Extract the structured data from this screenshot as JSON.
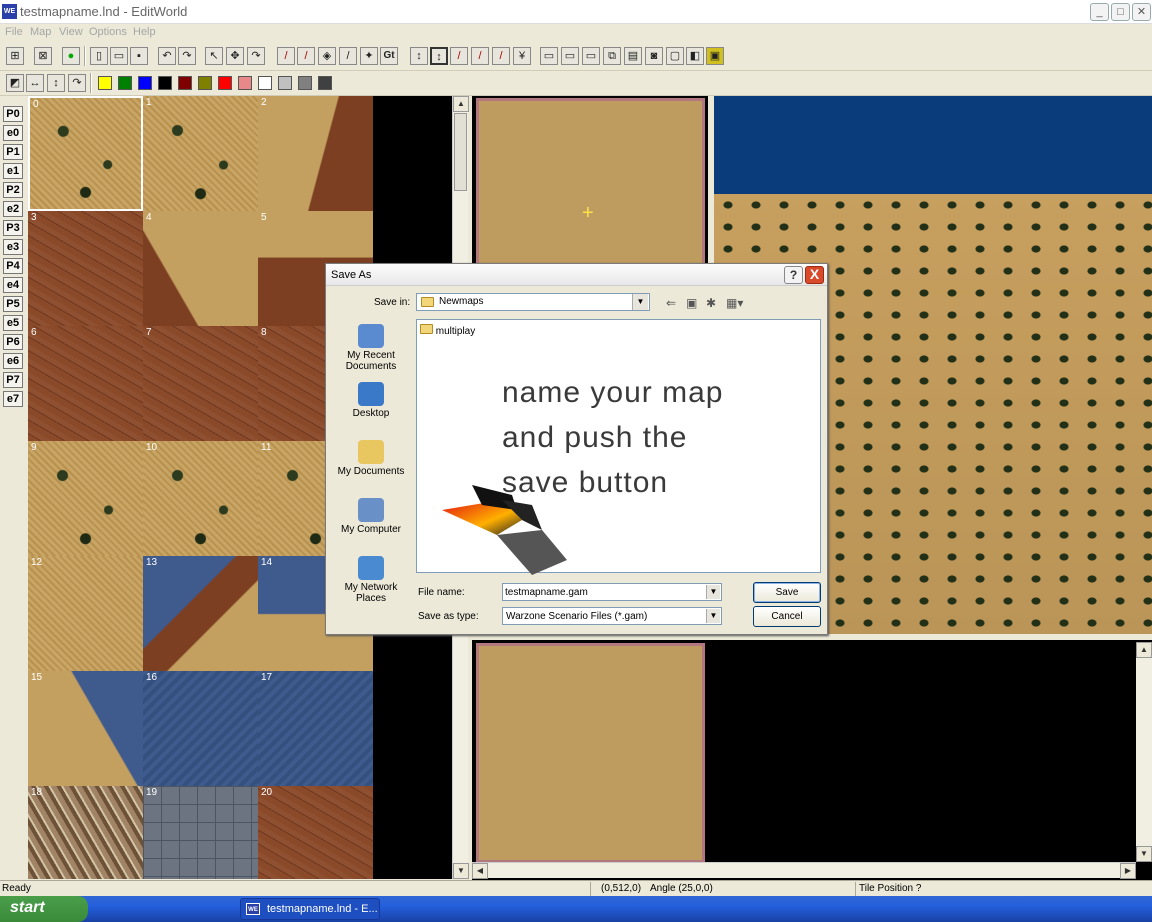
{
  "window": {
    "title": "testmapname.lnd - EditWorld",
    "app_icon": "WE"
  },
  "menu": [
    "File",
    "Map",
    "View",
    "Options",
    "Help"
  ],
  "toolbar1": {
    "gt_label": "Gt",
    "icons": [
      "toggle-icon",
      "target-icon",
      "circle-icon",
      "new-file-icon",
      "open-folder-icon",
      "save-icon",
      "undo-icon",
      "redo-icon",
      "pointer-icon",
      "move-icon",
      "rotate-icon",
      "paint-icon",
      "fill-icon",
      "height-icon",
      "flatten-icon",
      "smooth-icon",
      "gt-icon",
      "updown-icon",
      "updown2-icon",
      "brush-icon",
      "brush2-icon",
      "brush3-icon",
      "brush4-icon",
      "window-icon",
      "window2-icon",
      "window3-icon",
      "copy-icon",
      "paste-icon",
      "camera-icon",
      "view-icon",
      "play-icon",
      "settings-icon"
    ]
  },
  "toolbar2": {
    "swatches": [
      "#ffff00",
      "#008000",
      "#0000ff",
      "#000000",
      "#800000",
      "#808000",
      "#ff0000",
      "#e88888",
      "#ffffff",
      "#c0c0c0",
      "#808080",
      "#404040"
    ]
  },
  "players": [
    "P0",
    "e0",
    "P1",
    "e1",
    "P2",
    "e2",
    "P3",
    "e3",
    "P4",
    "e4",
    "P5",
    "e5",
    "P6",
    "e6",
    "P7",
    "e7"
  ],
  "tiles": [
    "0",
    "1",
    "2",
    "3",
    "4",
    "5",
    "6",
    "7",
    "8",
    "9",
    "10",
    "11",
    "12",
    "13",
    "14",
    "15",
    "16",
    "17",
    "18",
    "19",
    "20"
  ],
  "dialog": {
    "title": "Save As",
    "help": "?",
    "close": "X",
    "save_in_label": "Save in:",
    "save_in_value": "Newmaps",
    "places": [
      {
        "label1": "My Recent",
        "label2": "Documents",
        "color": "#5a8ad0"
      },
      {
        "label1": "Desktop",
        "label2": "",
        "color": "#3a78c8"
      },
      {
        "label1": "My Documents",
        "label2": "",
        "color": "#e8c660"
      },
      {
        "label1": "My Computer",
        "label2": "",
        "color": "#6a90c8"
      },
      {
        "label1": "My Network",
        "label2": "Places",
        "color": "#4a8ad0"
      }
    ],
    "files": [
      "multiplay"
    ],
    "overlay": [
      "name your map",
      "and push the",
      "save button"
    ],
    "file_name_label": "File name:",
    "file_name_value": "testmapname.gam",
    "save_type_label": "Save as type:",
    "save_type_value": "Warzone Scenario Files (*.gam)",
    "save_button": "Save",
    "cancel_button": "Cancel"
  },
  "status": {
    "text": "Ready",
    "coords": "(0,512,0)",
    "angle": "Angle (25,0,0)",
    "tile_pos": "Tile Position ?"
  },
  "taskbar": {
    "start": "start",
    "item": "testmapname.lnd - E...",
    "item_icon": "WE"
  }
}
